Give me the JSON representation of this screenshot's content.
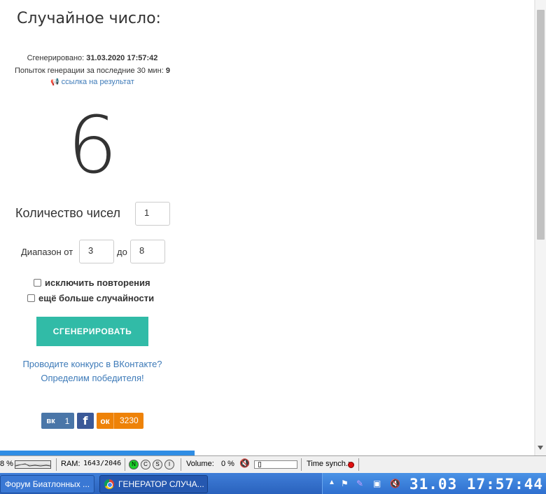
{
  "page": {
    "title": "Случайное число:",
    "generated_label": "Сгенерировано:",
    "generated_value": "31.03.2020 17:57:42",
    "attempts_label": "Попыток генерации за последние 30 мин:",
    "attempts_value": "9",
    "result_link": "ссылка на результат",
    "result_number": "6",
    "count_label": "Количество чисел",
    "count_value": "1",
    "range_label": "Диапазон от",
    "range_from": "3",
    "range_to_label": "до",
    "range_to": "8",
    "option_no_repeat": "исключить повторения",
    "option_more_random": "ещё больше случайности",
    "generate_button": "СГЕНЕРИРОВАТЬ",
    "promo_line1": "Проводите конкурс в ВКонтакте?",
    "promo_line2": "Определим победителя!"
  },
  "social": {
    "vk_label": "вк",
    "vk_count": "1",
    "fb_label": "f",
    "ok_label": "ок",
    "ok_count": "3230"
  },
  "sysbar": {
    "cpu_percent": "8 %",
    "ram_label": "RAM:",
    "ram_value": "1643/2046",
    "btn_n": "N",
    "btn_c": "C",
    "btn_s": "S",
    "btn_i": "I",
    "volume_label": "Volume:",
    "volume_value": "0 %",
    "volume_level": 0.05,
    "time_synch_label": "Time synch.:"
  },
  "taskbar": {
    "task1_label": "Форум Биатлонных ...",
    "task2_label": "ГЕНЕРАТОР СЛУЧА...",
    "clock": "31.03 17:57:44"
  },
  "colors": {
    "accent_button": "#31bba7",
    "link": "#3d7ab8",
    "vk": "#4a76a8",
    "fb": "#3b5998",
    "ok": "#ee8208",
    "taskbar": "#2a62bd"
  }
}
